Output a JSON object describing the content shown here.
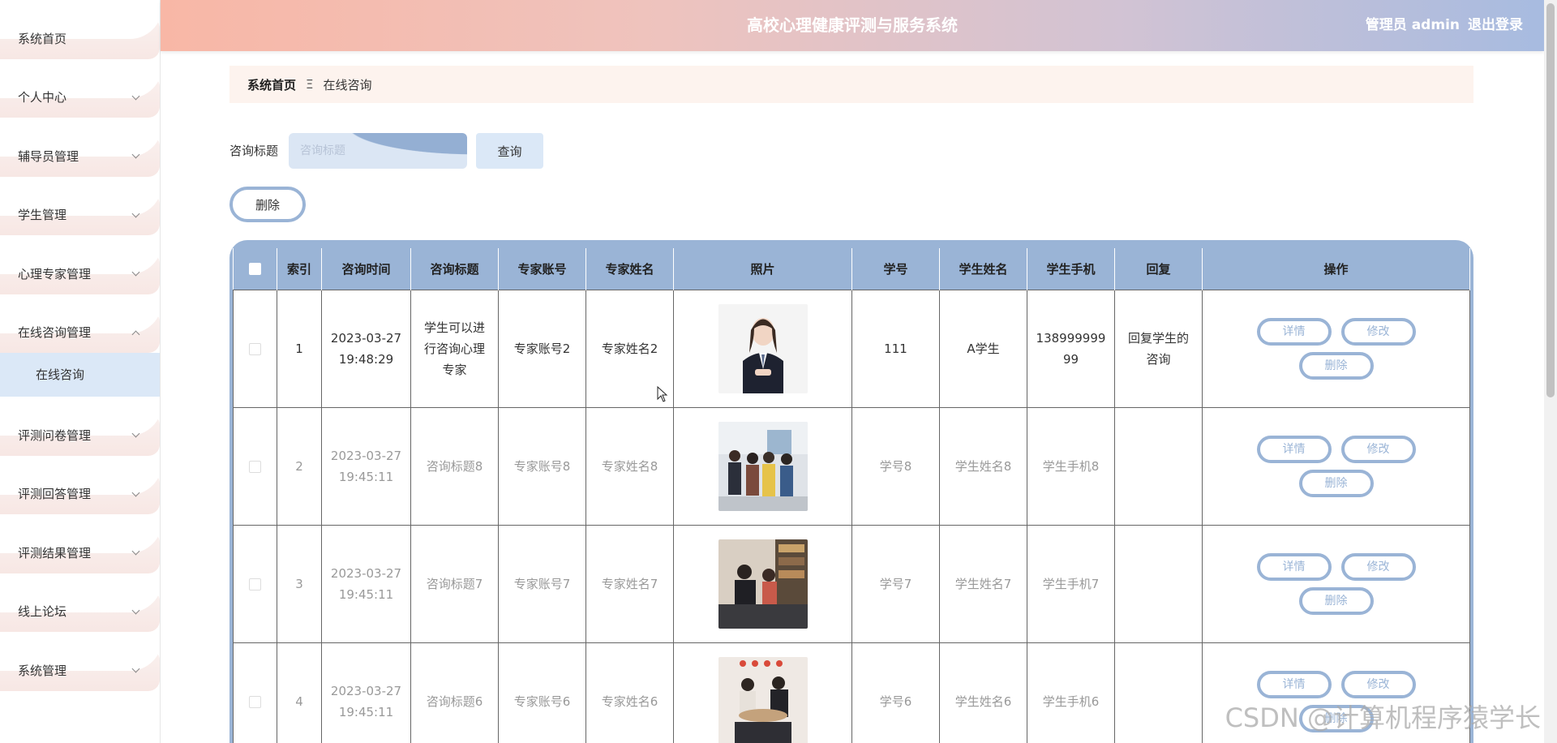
{
  "app": {
    "title": "高校心理健康评测与服务系统",
    "user_label": "管理员 admin",
    "logout_label": "退出登录"
  },
  "sidebar": {
    "items": [
      {
        "label": "系统首页",
        "has_arrow": false
      },
      {
        "label": "个人中心",
        "has_arrow": true
      },
      {
        "label": "辅导员管理",
        "has_arrow": true
      },
      {
        "label": "学生管理",
        "has_arrow": true
      },
      {
        "label": "心理专家管理",
        "has_arrow": true
      },
      {
        "label": "在线咨询管理",
        "has_arrow": true,
        "expanded": true
      }
    ],
    "submenu": [
      {
        "label": "在线咨询",
        "active": true
      }
    ],
    "items_after": [
      {
        "label": "评测问卷管理"
      },
      {
        "label": "评测回答管理"
      },
      {
        "label": "评测结果管理"
      },
      {
        "label": "线上论坛"
      },
      {
        "label": "系统管理"
      }
    ]
  },
  "breadcrumb": {
    "home": "系统首页",
    "separator": "Ξ",
    "current": "在线咨询"
  },
  "search": {
    "label": "咨询标题",
    "placeholder": "咨询标题",
    "button": "查询"
  },
  "actions": {
    "delete_label": "删除"
  },
  "table": {
    "columns": [
      "索引",
      "咨询时间",
      "咨询标题",
      "专家账号",
      "专家姓名",
      "照片",
      "学号",
      "学生姓名",
      "学生手机",
      "回复",
      "操作"
    ],
    "row_buttons": {
      "detail": "详情",
      "edit": "修改",
      "delete": "删除"
    },
    "rows": [
      {
        "index": "1",
        "time": "2023-03-27 19:48:29",
        "title": "学生可以进行咨询心理专家",
        "expert_account": "专家账号2",
        "expert_name": "专家姓名2",
        "photo": "professional-woman-photo",
        "student_id": "111",
        "student_name": "A学生",
        "student_phone": "13899999999",
        "reply": "回复学生的咨询"
      },
      {
        "index": "2",
        "time": "2023-03-27 19:45:11",
        "title": "咨询标题8",
        "expert_account": "专家账号8",
        "expert_name": "专家姓名8",
        "photo": "group-people-photo",
        "student_id": "学号8",
        "student_name": "学生姓名8",
        "student_phone": "学生手机8",
        "reply": ""
      },
      {
        "index": "3",
        "time": "2023-03-27 19:45:11",
        "title": "咨询标题7",
        "expert_account": "专家账号7",
        "expert_name": "专家姓名7",
        "photo": "counseling-room-photo",
        "student_id": "学号7",
        "student_name": "学生姓名7",
        "student_phone": "学生手机7",
        "reply": ""
      },
      {
        "index": "4",
        "time": "2023-03-27 19:45:11",
        "title": "咨询标题6",
        "expert_account": "专家账号6",
        "expert_name": "专家姓名6",
        "photo": "meeting-photo",
        "student_id": "学号6",
        "student_name": "学生姓名6",
        "student_phone": "学生手机6",
        "reply": ""
      }
    ]
  },
  "watermark": "CSDN @计算机程序猿学长",
  "colors": {
    "accent": "#9ab4d6",
    "submenu_active": "#dbe8f7",
    "breadcrumb_bg": "#fdf3ee"
  }
}
